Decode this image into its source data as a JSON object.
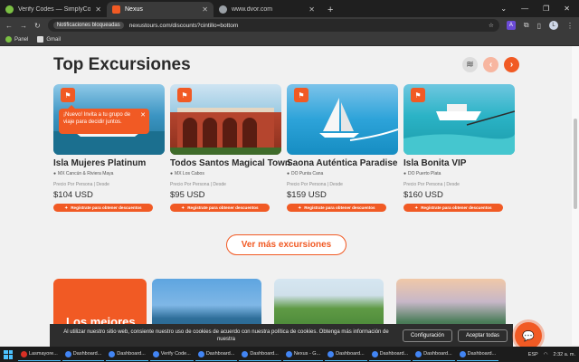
{
  "tabs": [
    {
      "label": "Verify Codes — SimplyCodes",
      "color": "#7bc043",
      "active": false
    },
    {
      "label": "Nexus",
      "color": "#f15a24",
      "active": true
    },
    {
      "label": "www.dvor.com",
      "color": "#9aa0a6",
      "active": false
    }
  ],
  "toolbar": {
    "security_chip": "Notificaciones bloqueadas",
    "url": "nexustours.com/discounts?cintillo=bottom",
    "extension_label": "A",
    "profile_initial": "L"
  },
  "bookmarks": [
    {
      "label": "Panel",
      "color": "#7bc043"
    },
    {
      "label": "Gmail",
      "color": "#dddddd"
    }
  ],
  "section": {
    "title": "Top Excursiones",
    "more_label": "Ver más excursiones"
  },
  "tooltip": {
    "text": "¡Nuevo! Invita a tu grupo de viaje para decidir juntos."
  },
  "cards": [
    {
      "name": "Isla Mujeres Platinum",
      "location": "MX Cancún & Riviera Maya",
      "per": "Precio Por Persona | Desde",
      "price": "$104 USD",
      "promo": "Regístrate para obtener descuentos",
      "bg": "#2e7fa7"
    },
    {
      "name": "Todos Santos Magical Town",
      "location": "MX Los Cabos",
      "per": "Precio Por Persona | Desde",
      "price": "$95 USD",
      "promo": "Regístrate para obtener descuentos",
      "bg": "#b5452e"
    },
    {
      "name": "Saona Auténtica Paradise",
      "location": "DO Punta Cana",
      "per": "Precio Por Persona | Desde",
      "price": "$159 USD",
      "promo": "Regístrate para obtener descuentos",
      "bg": "#1c8fc4"
    },
    {
      "name": "Isla Bonita VIP",
      "location": "DO Puerto Plata",
      "per": "Precio Por Persona | Desde",
      "price": "$160 USD",
      "promo": "Regístrate para obtener descuentos",
      "bg": "#23a7b8"
    }
  ],
  "bottom_tiles": {
    "orange_text": "Los mejores"
  },
  "cookie": {
    "text": "Al utilizar nuestro sitio web, consiente nuestro uso de cookies de acuerdo con nuestra política de cookies. Obtenga más información de nuestra",
    "settings_label": "Configuración",
    "accept_label": "Aceptar todas"
  },
  "taskbar": {
    "items": [
      {
        "label": "Lasmayore...",
        "color": "#d93025"
      },
      {
        "label": "Dashboard...",
        "color": "#4285f4"
      },
      {
        "label": "Dashboard...",
        "color": "#4285f4"
      },
      {
        "label": "Verify Code...",
        "color": "#4285f4"
      },
      {
        "label": "Dashboard...",
        "color": "#4285f4"
      },
      {
        "label": "Dashboard...",
        "color": "#4285f4"
      },
      {
        "label": "Nexus - G...",
        "color": "#4285f4"
      },
      {
        "label": "Dashboard...",
        "color": "#4285f4"
      },
      {
        "label": "Dashboard...",
        "color": "#4285f4"
      },
      {
        "label": "Dashboard...",
        "color": "#4285f4"
      },
      {
        "label": "Dashboard...",
        "color": "#4285f4"
      }
    ],
    "language": "ESP",
    "time": "2:32 a. m."
  }
}
